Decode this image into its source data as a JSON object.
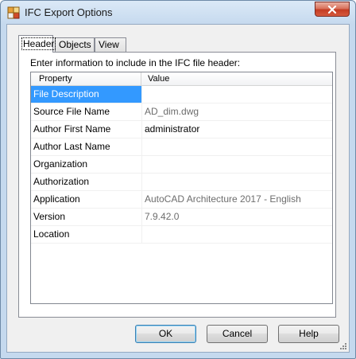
{
  "window": {
    "title": "IFC Export Options",
    "close_symbol": "✕"
  },
  "tabs": [
    {
      "label": "Header",
      "active": true
    },
    {
      "label": "Objects",
      "active": false
    },
    {
      "label": "View",
      "active": false
    }
  ],
  "header_tab": {
    "instruction": "Enter information to include in the IFC file header:",
    "columns": {
      "property": "Property",
      "value": "Value"
    },
    "rows": [
      {
        "name": "File Description",
        "value": ""
      },
      {
        "name": "Source File Name",
        "value": "AD_dim.dwg"
      },
      {
        "name": "Author First Name",
        "value": "administrator"
      },
      {
        "name": "Author Last Name",
        "value": ""
      },
      {
        "name": "Organization",
        "value": ""
      },
      {
        "name": "Authorization",
        "value": ""
      },
      {
        "name": "Application",
        "value": "AutoCAD Architecture 2017 - English"
      },
      {
        "name": "Version",
        "value": "7.9.42.0"
      },
      {
        "name": "Location",
        "value": ""
      }
    ]
  },
  "buttons": {
    "ok": "OK",
    "cancel": "Cancel",
    "help": "Help"
  }
}
